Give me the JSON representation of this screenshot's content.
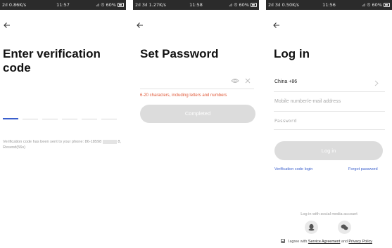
{
  "phones": [
    {
      "status": {
        "signal": "2ıl 0.86K/s",
        "time": "11:57",
        "right": "⊿ ⏲ 60%"
      },
      "title": "Enter verification code",
      "hint": "Verification code has been sent to your phone: 86-18598",
      "hint_tail": "8, Resend(56s)"
    },
    {
      "status": {
        "signal": "2ıl 3ıl 1.27K/s",
        "time": "11:58",
        "right": "⊿ ⏲ 60%"
      },
      "title": "Set Password",
      "rule": "6-20 characters, including letters and numbers",
      "button": "Completed"
    },
    {
      "status": {
        "signal": "2ıl 3ıl 0.50K/s",
        "time": "11:56",
        "right": "⊿ ⏲ 60%"
      },
      "title": "Log in",
      "country": "China +86",
      "phone_placeholder": "Mobile number/e-mail address",
      "password_placeholder": "Password",
      "button": "Log in",
      "link_code": "Verification code login",
      "link_forgot": "Forgot password",
      "social_title": "Log in with social media account",
      "agree_prefix": "I agree with",
      "agree_link1": "Service Agreement",
      "agree_and": "and",
      "agree_link2": "Privacy Policy"
    }
  ],
  "icons": [
    "back-arrow-icon",
    "eye-icon",
    "close-icon",
    "chevron-right-icon",
    "qq-icon",
    "wechat-icon",
    "checkbox-icon"
  ],
  "colors": {
    "accent": "#3a5fcd",
    "warning": "#e05a3a",
    "disabled_button": "#dcdcdc"
  }
}
